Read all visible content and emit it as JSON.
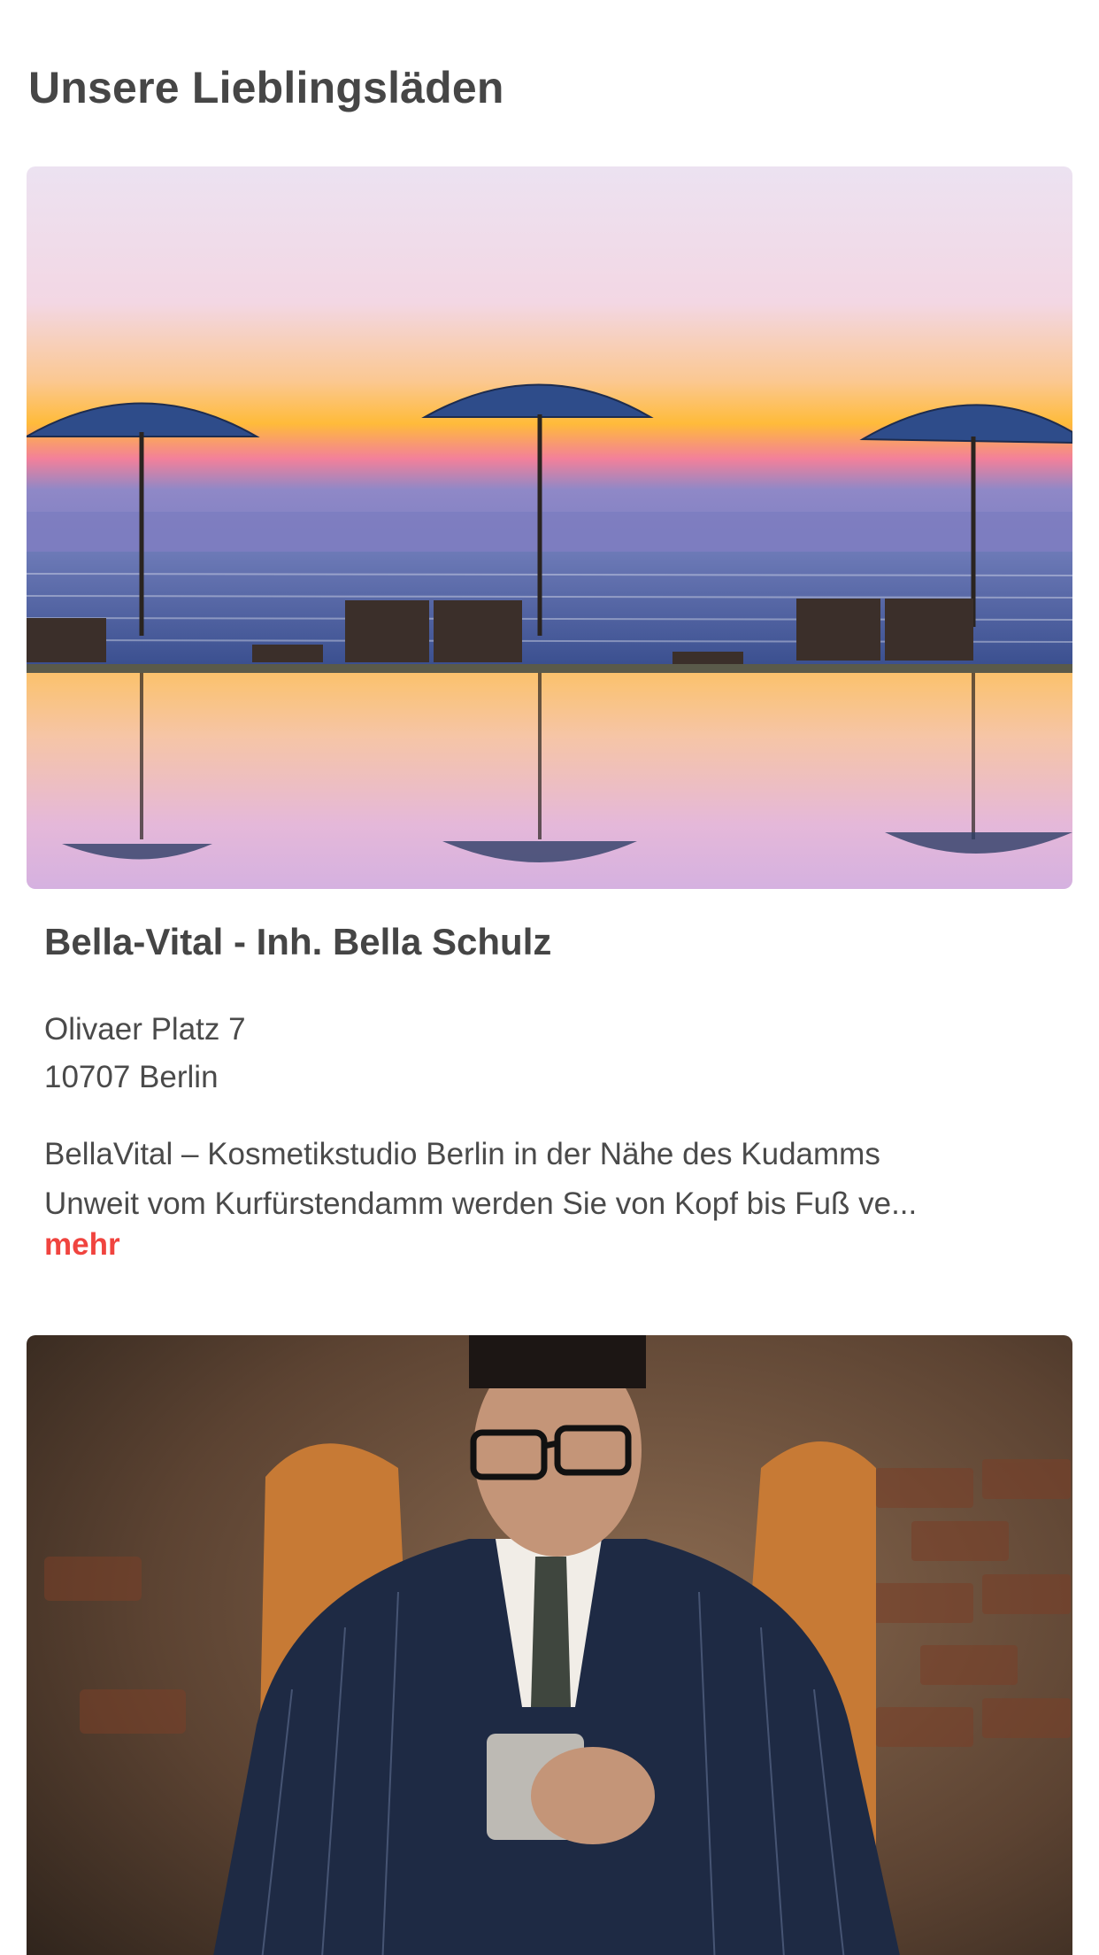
{
  "section": {
    "title": "Unsere Lieblingsläden"
  },
  "shops": [
    {
      "name": "Bella-Vital - Inh. Bella Schulz",
      "address_line1": "Olivaer Platz 7",
      "address_line2": "10707 Berlin",
      "description_line1": "BellaVital – Kosmetikstudio Berlin in der Nähe des Kudamms",
      "description_line2": "Unweit vom Kurfürstendamm werden Sie von Kopf bis Fuß ve...",
      "more_label": "mehr",
      "image": "beach-umbrellas-sunset-photo"
    },
    {
      "image": "man-in-suit-with-glass-photo"
    }
  ],
  "colors": {
    "accent": "#f0443f",
    "text": "#454545",
    "background": "#ffffff"
  }
}
